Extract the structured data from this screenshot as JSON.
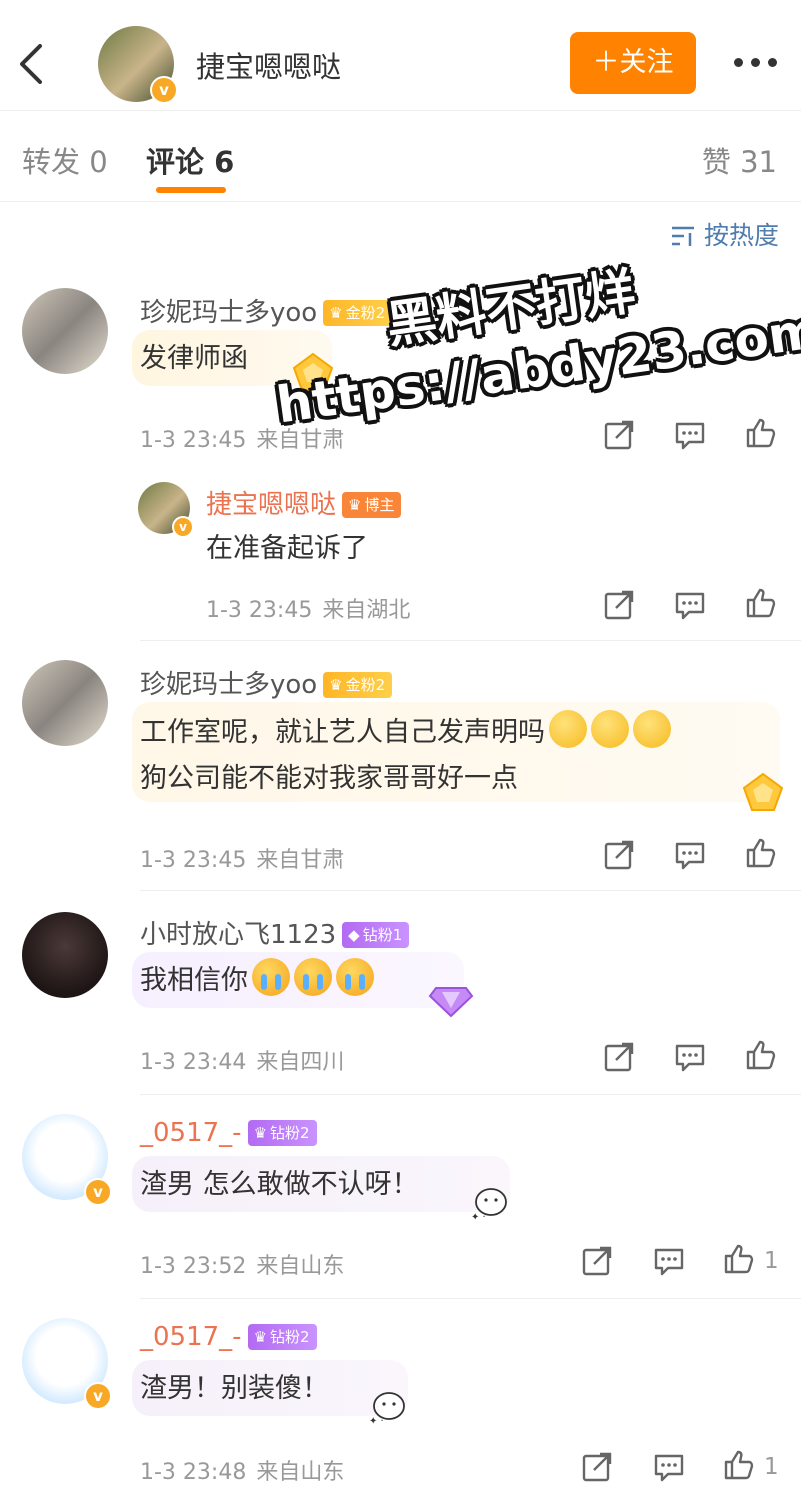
{
  "header": {
    "back_icon": "chevron-left-icon",
    "username": "捷宝嗯嗯哒",
    "follow_label": "＋关注",
    "more_icon": "more-dots-icon"
  },
  "tabs": [
    {
      "label": "转发 0"
    },
    {
      "label": "评论 6",
      "active": true
    },
    {
      "label": "赞 31"
    }
  ],
  "sort": {
    "label": "按热度",
    "icon": "sort-icon"
  },
  "watermark": {
    "line1": "黑料不打烊",
    "line2": "https://abdy23.com"
  },
  "comments": [
    {
      "user": "珍妮玛士多yoo",
      "badge": "金粉2",
      "text": "发律师函",
      "time": "1-3 23:45",
      "location": "来自甘肃",
      "likes": ""
    },
    {
      "user": "捷宝嗯嗯哒",
      "badge": "博主",
      "text": "在准备起诉了",
      "time": "1-3 23:45",
      "location": "来自湖北",
      "likes": "",
      "reply": true
    },
    {
      "user": "珍妮玛士多yoo",
      "badge": "金粉2",
      "text_line1": "工作室呢，就让艺人自己发声明吗",
      "text_line2": "狗公司能不能对我家哥哥好一点",
      "time": "1-3 23:45",
      "location": "来自甘肃",
      "likes": ""
    },
    {
      "user": "小时放心飞1123",
      "badge": "钻粉1",
      "text": "我相信你",
      "time": "1-3 23:44",
      "location": "来自四川",
      "likes": ""
    },
    {
      "user": "_0517_-",
      "badge": "钻粉2",
      "text": "渣男 怎么敢做不认呀！",
      "time": "1-3 23:52",
      "location": "来自山东",
      "likes": "1"
    },
    {
      "user": "_0517_-",
      "badge": "钻粉2",
      "text": "渣男！别装傻！",
      "time": "1-3 23:48",
      "location": "来自山东",
      "likes": "1"
    }
  ],
  "colors": {
    "accent": "#ff8200",
    "link": "#507daf",
    "name_orange": "#eb7350"
  }
}
